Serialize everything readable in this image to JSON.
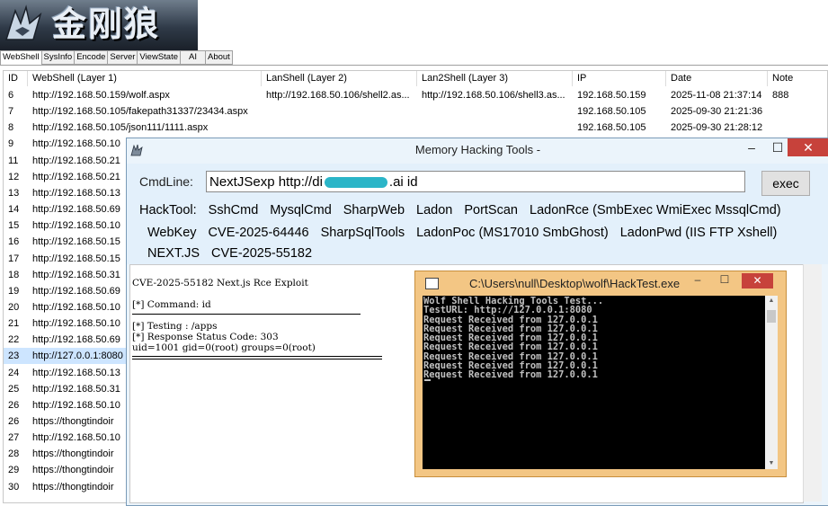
{
  "app": {
    "logo_text": "金刚狼",
    "tabs": [
      "WebShell",
      "SysInfo",
      "Encode",
      "Server",
      "ViewState",
      "AI",
      "About"
    ]
  },
  "table": {
    "columns": [
      "ID",
      "WebShell (Layer 1)",
      "LanShell (Layer 2)",
      "Lan2Shell (Layer 3)",
      "IP",
      "Date",
      "Note"
    ],
    "rows": [
      {
        "id": "6",
        "shell": "http://192.168.50.159/wolf.aspx",
        "lan": "http://192.168.50.106/shell2.as...",
        "lan2": "http://192.168.50.106/shell3.as...",
        "ip": "192.168.50.159",
        "date": "2025-11-08 21:37:14",
        "note": "888"
      },
      {
        "id": "7",
        "shell": "http://192.168.50.105/fakepath31337/23434.aspx",
        "lan": "",
        "lan2": "",
        "ip": "192.168.50.105",
        "date": "2025-09-30 21:21:36",
        "note": ""
      },
      {
        "id": "8",
        "shell": "http://192.168.50.105/json111/1111.aspx",
        "lan": "",
        "lan2": "",
        "ip": "192.168.50.105",
        "date": "2025-09-30 21:28:12",
        "note": ""
      },
      {
        "id": "9",
        "shell": "http://192.168.50.10"
      },
      {
        "id": "11",
        "shell": "http://192.168.50.21"
      },
      {
        "id": "12",
        "shell": "http://192.168.50.21"
      },
      {
        "id": "13",
        "shell": "http://192.168.50.13"
      },
      {
        "id": "14",
        "shell": "http://192.168.50.69"
      },
      {
        "id": "15",
        "shell": "http://192.168.50.10"
      },
      {
        "id": "16",
        "shell": "http://192.168.50.15"
      },
      {
        "id": "17",
        "shell": "http://192.168.50.15"
      },
      {
        "id": "18",
        "shell": "http://192.168.50.31"
      },
      {
        "id": "19",
        "shell": "http://192.168.50.69"
      },
      {
        "id": "20",
        "shell": "http://192.168.50.10"
      },
      {
        "id": "21",
        "shell": "http://192.168.50.10"
      },
      {
        "id": "22",
        "shell": "http://192.168.50.69"
      },
      {
        "id": "23",
        "shell": "http://127.0.0.1:8080",
        "selected": true
      },
      {
        "id": "24",
        "shell": "http://192.168.50.13"
      },
      {
        "id": "25",
        "shell": "http://192.168.50.31"
      },
      {
        "id": "26",
        "shell": "http://192.168.50.10"
      },
      {
        "id": "26",
        "shell": "https://thongtindoir"
      },
      {
        "id": "27",
        "shell": "http://192.168.50.10"
      },
      {
        "id": "28",
        "shell": "https://thongtindoir"
      },
      {
        "id": "29",
        "shell": "https://thongtindoir"
      },
      {
        "id": "30",
        "shell": "https://thongtindoir"
      }
    ]
  },
  "mht": {
    "title": "Memory Hacking Tools -",
    "cmd_label": "CmdLine:",
    "cmd_prefix": "NextJSexp http://di",
    "cmd_suffix": ".ai id",
    "exec_label": "exec",
    "tool_line1": [
      "HackTool:",
      "SshCmd",
      "MysqlCmd",
      "SharpWeb",
      "Ladon",
      "PortScan",
      "LadonRce (SmbExec WmiExec MssqlCmd)"
    ],
    "tool_line2": [
      "WebKey",
      "CVE-2025-64446",
      "SharpSqlTools",
      "LadonPoc (MS17010 SmbGhost)",
      "LadonPwd (IIS FTP Xshell)"
    ],
    "tool_line3": [
      "NEXT.JS",
      "CVE-2025-55182"
    ],
    "output": {
      "line1": "CVE-2025-55182 Next.js Rce Exploit",
      "line2": "[*] Command: id",
      "line3": "[*] Testing : /apps",
      "line4": "[*] Response Status Code: 303",
      "line5": "uid=1001 gid=0(root) groups=0(root)"
    }
  },
  "console": {
    "title": "C:\\Users\\null\\Desktop\\wolf\\HackTest.exe",
    "text": "Wolf Shell Hacking Tools Test...\nTestURL: http://127.0.0.1:8080\nRequest Received from 127.0.0.1\nRequest Received from 127.0.0.1\nRequest Received from 127.0.0.1\nRequest Received from 127.0.0.1\nRequest Received from 127.0.0.1\nRequest Received from 127.0.0.1\nRequest Received from 127.0.0.1"
  }
}
